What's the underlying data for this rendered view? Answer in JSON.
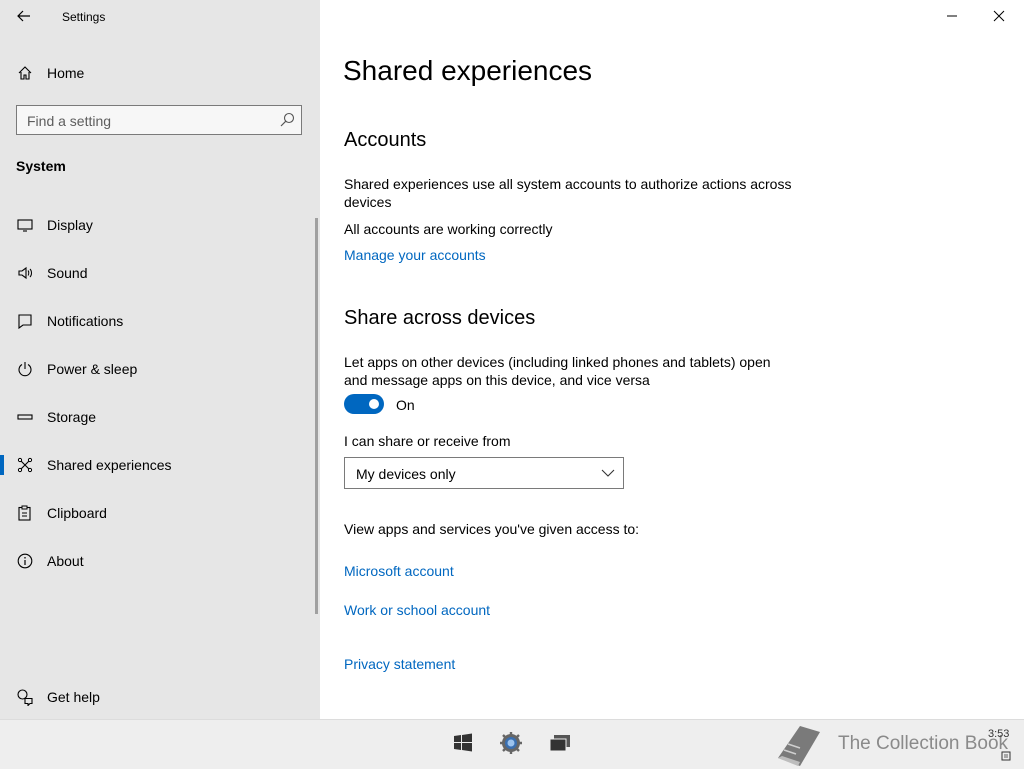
{
  "window": {
    "title": "Settings"
  },
  "sidebar": {
    "home_label": "Home",
    "search_placeholder": "Find a setting",
    "section": "System",
    "items": [
      {
        "label": "Display",
        "icon": "display-icon"
      },
      {
        "label": "Sound",
        "icon": "speaker-icon"
      },
      {
        "label": "Notifications",
        "icon": "notification-icon"
      },
      {
        "label": "Power & sleep",
        "icon": "power-icon"
      },
      {
        "label": "Storage",
        "icon": "storage-icon"
      },
      {
        "label": "Shared experiences",
        "icon": "shared-icon",
        "selected": true
      },
      {
        "label": "Clipboard",
        "icon": "clipboard-icon"
      },
      {
        "label": "About",
        "icon": "info-icon"
      }
    ],
    "get_help": "Get help"
  },
  "main": {
    "title": "Shared experiences",
    "accounts": {
      "heading": "Accounts",
      "description": "Shared experiences use all system accounts to authorize actions across devices",
      "status": "All accounts are working correctly",
      "manage_link": "Manage your accounts"
    },
    "share": {
      "heading": "Share across devices",
      "description": "Let apps on other devices (including linked phones and tablets) open and message apps on this device, and vice versa",
      "toggle_state": "On",
      "share_label": "I can share or receive from",
      "dropdown_value": "My devices only"
    },
    "access_text": "View apps and services you've given access to:",
    "microsoft_link": "Microsoft account",
    "work_link": "Work or school account",
    "privacy_link": "Privacy statement"
  },
  "taskbar": {
    "watermark": "The Collection Book",
    "clock": "3:53"
  },
  "colors": {
    "accent": "#0067c0",
    "sidebar_bg": "#e6e6e6"
  }
}
